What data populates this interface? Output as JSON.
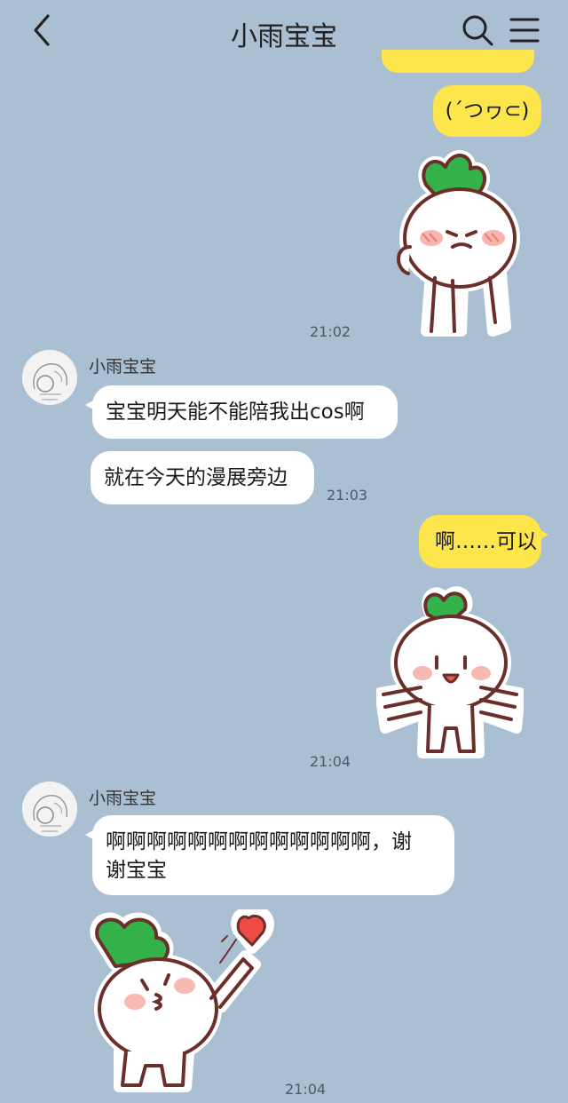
{
  "header": {
    "title": "小雨宝宝",
    "back_icon": "chevron-left-icon",
    "search_icon": "search-icon",
    "menu_icon": "hamburger-menu-icon"
  },
  "messages": {
    "m1": {
      "text": "(´つヮ⊂)"
    },
    "t1": "21:02",
    "n1": "小雨宝宝",
    "m2": {
      "text": "宝宝明天能不能陪我出cos啊"
    },
    "m3": {
      "text": "就在今天的漫展旁边"
    },
    "t2": "21:03",
    "m4": {
      "text": "啊……可以"
    },
    "t3": "21:04",
    "n2": "小雨宝宝",
    "m5": {
      "line1": "啊啊啊啊啊啊啊啊啊啊啊啊啊，谢",
      "line2": "谢宝宝"
    },
    "t4": "21:04"
  },
  "colors": {
    "background": "#aabfd2",
    "my_bubble": "#fde54c",
    "their_bubble": "#ffffff",
    "sticker_leaf": "#33b24a"
  }
}
